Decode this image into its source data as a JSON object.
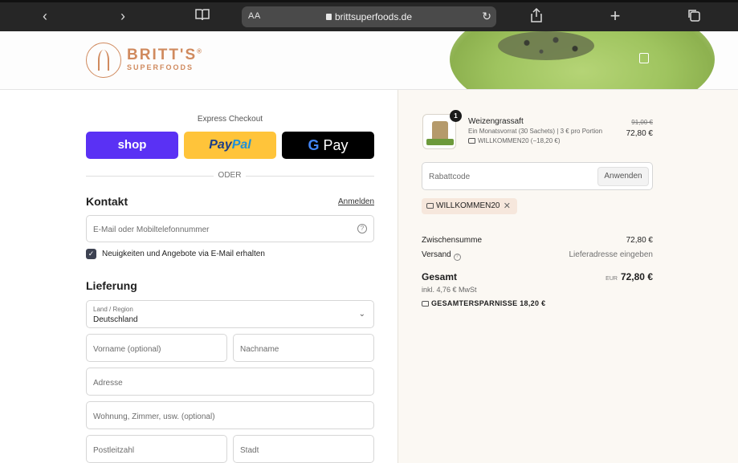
{
  "browser": {
    "reader_label": "AA",
    "url": "brittsuperfoods.de"
  },
  "brand": {
    "name": "BRITT'S",
    "registered": "®",
    "subtitle": "SUPERFOODS",
    "color": "#d08a5e"
  },
  "checkout": {
    "express_title": "Express Checkout",
    "shop_label": "shop",
    "paypal_label_1": "Pay",
    "paypal_label_2": "Pal",
    "gpay_g": "G",
    "gpay_label": "Pay",
    "divider_label": "ODER",
    "contact_heading": "Kontakt",
    "login_link": "Anmelden",
    "email_placeholder": "E-Mail oder Mobiltelefonnummer",
    "newsletter_label": "Neuigkeiten und Angebote via E-Mail erhalten",
    "newsletter_checked": true,
    "delivery_heading": "Lieferung",
    "country_label": "Land / Region",
    "country_value": "Deutschland",
    "firstname_placeholder": "Vorname (optional)",
    "lastname_placeholder": "Nachname",
    "address_placeholder": "Adresse",
    "apartment_placeholder": "Wohnung, Zimmer, usw. (optional)",
    "zip_placeholder": "Postleitzahl",
    "city_placeholder": "Stadt",
    "colors": {
      "shop": "#5a31f4",
      "paypal": "#ffc43a",
      "gpay": "#000000",
      "checkbox": "#3d4252"
    }
  },
  "summary": {
    "item": {
      "quantity": "1",
      "name": "Weizengrassaft",
      "description": "Ein Monatsvorrat (30 Sachets) | 3 € pro Portion",
      "discount": "WILLKOMMEN20 (−18,20 €)",
      "old_price": "91,00 €",
      "price": "72,80 €"
    },
    "code_placeholder": "Rabattcode",
    "apply_label": "Anwenden",
    "applied_code": "WILLKOMMEN20",
    "subtotal_label": "Zwischensumme",
    "subtotal_value": "72,80 €",
    "shipping_label": "Versand",
    "shipping_value": "Lieferadresse eingeben",
    "total_label": "Gesamt",
    "total_currency": "EUR",
    "total_value": "72,80 €",
    "vat_text": "inkl. 4,76 € MwSt",
    "savings_text": "GESAMTERSPARNISSE 18,20 €"
  }
}
